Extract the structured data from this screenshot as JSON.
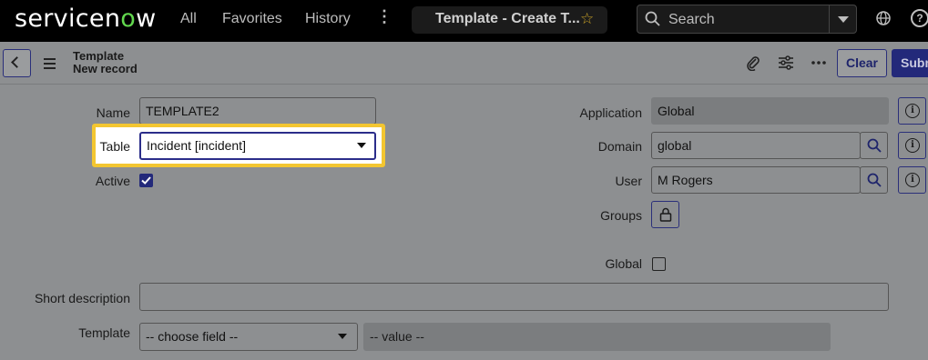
{
  "nav": {
    "logo_prefix": "servicen",
    "logo_o": "o",
    "logo_suffix": "w",
    "all": "All",
    "favorites": "Favorites",
    "history": "History",
    "more": "⋮",
    "tab_title": "Template - Create T...",
    "search_placeholder": "Search"
  },
  "header": {
    "title_line1": "Template",
    "title_line2": "New record",
    "clear_label": "Clear",
    "submit_label": "Subm"
  },
  "form": {
    "name_label": "Name",
    "name_value": "TEMPLATE2",
    "table_label": "Table",
    "table_value": "Incident [incident]",
    "active_label": "Active",
    "active_checked": true,
    "application_label": "Application",
    "application_value": "Global",
    "domain_label": "Domain",
    "domain_value": "global",
    "user_label": "User",
    "user_value": "M Rogers",
    "groups_label": "Groups",
    "global_label": "Global",
    "global_checked": false,
    "short_description_label": "Short description",
    "short_description_value": "",
    "template_label": "Template",
    "template_field_value": "-- choose field --",
    "template_value_placeholder": "-- value --"
  },
  "colors": {
    "accent": "#23297a",
    "highlight": "#f3c631",
    "logo_green": "#62d84e"
  }
}
